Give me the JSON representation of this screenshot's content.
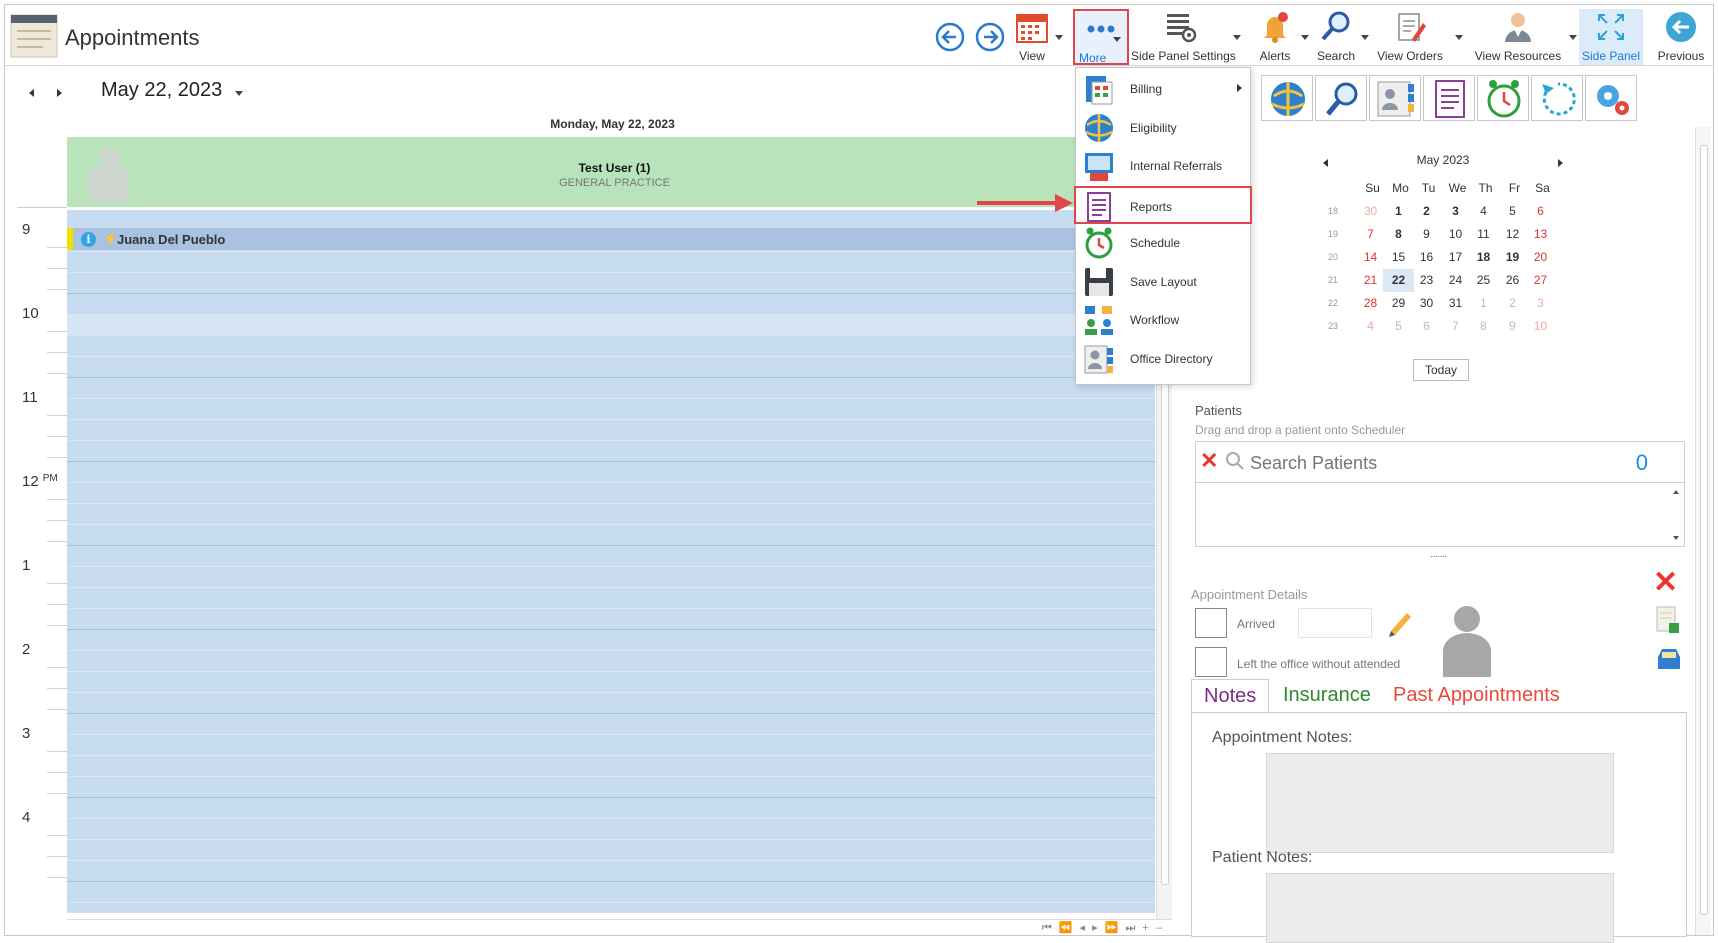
{
  "app": {
    "title": "Appointments"
  },
  "toolbar": {
    "items": [
      {
        "label": "View",
        "icon": "calendar-icon"
      },
      {
        "label": "More",
        "icon": "more-dots-icon"
      },
      {
        "label": "Side Panel Settings",
        "icon": "panel-settings-icon"
      },
      {
        "label": "Alerts",
        "icon": "bell-icon"
      },
      {
        "label": "Search",
        "icon": "search-icon"
      },
      {
        "label": "View Orders",
        "icon": "orders-icon"
      },
      {
        "label": "View Resources",
        "icon": "resources-icon"
      },
      {
        "label": "Side Panel",
        "icon": "expand-icon"
      },
      {
        "label": "Previous",
        "icon": "back-arrow-icon"
      }
    ]
  },
  "scheduler": {
    "current_date": "May 22, 2023",
    "day_header": "Monday, May 22, 2023",
    "resource": {
      "name": "Test User (1)",
      "subtitle": "GENERAL PRACTICE"
    },
    "hours": [
      "9",
      "10",
      "11",
      "12",
      "1",
      "2",
      "3",
      "4"
    ],
    "pm_label": "PM",
    "appointment": {
      "patient": "Juana Del Pueblo",
      "hour": "9"
    },
    "hscroll_nav": "⏮ ⏪ ◂ ▸ ⏩ ⏭ + –"
  },
  "more_menu": {
    "items": [
      {
        "label": "Billing",
        "icon": "billing-icon",
        "has_submenu": true
      },
      {
        "label": "Eligibility",
        "icon": "eligibility-icon",
        "has_submenu": false
      },
      {
        "label": "Internal Referrals",
        "icon": "referrals-icon",
        "has_submenu": false
      },
      {
        "label": "Reports",
        "icon": "reports-icon",
        "has_submenu": false,
        "highlighted": true
      },
      {
        "label": "Schedule",
        "icon": "alarm-clock-icon",
        "has_submenu": false
      },
      {
        "label": "Save Layout",
        "icon": "floppy-disk-icon",
        "has_submenu": false
      },
      {
        "label": "Workflow",
        "icon": "workflow-icon",
        "has_submenu": false
      },
      {
        "label": "Office Directory",
        "icon": "directory-icon",
        "has_submenu": false
      }
    ]
  },
  "side_panel": {
    "quick_icons": [
      "eligibility-icon",
      "search-icon",
      "directory-icon",
      "reports-icon",
      "alarm-clock-icon",
      "refresh-icon",
      "settings-gears-icon"
    ],
    "calendar": {
      "month_label": "May 2023",
      "weekdays": [
        "Su",
        "Mo",
        "Tu",
        "We",
        "Th",
        "Fr",
        "Sa"
      ],
      "weeks": [
        {
          "wk": "18",
          "days": [
            "30",
            "1",
            "2",
            "3",
            "4",
            "5",
            "6"
          ]
        },
        {
          "wk": "19",
          "days": [
            "7",
            "8",
            "9",
            "10",
            "11",
            "12",
            "13"
          ]
        },
        {
          "wk": "20",
          "days": [
            "14",
            "15",
            "16",
            "17",
            "18",
            "19",
            "20"
          ]
        },
        {
          "wk": "21",
          "days": [
            "21",
            "22",
            "23",
            "24",
            "25",
            "26",
            "27"
          ]
        },
        {
          "wk": "22",
          "days": [
            "28",
            "29",
            "30",
            "31",
            "1",
            "2",
            "3"
          ]
        },
        {
          "wk": "23",
          "days": [
            "4",
            "5",
            "6",
            "7",
            "8",
            "9",
            "10"
          ]
        }
      ],
      "selected": "22",
      "today_label": "Today"
    },
    "patients": {
      "title": "Patients",
      "hint": "Drag and drop a patient onto Scheduler",
      "search_placeholder": "Search Patients",
      "count": "0"
    },
    "appointment_details": {
      "title": "Appointment Details",
      "arrived_label": "Arrived",
      "left_label": "Left the office without attended"
    },
    "tabs": [
      "Notes",
      "Insurance",
      "Past Appointments"
    ],
    "notes": {
      "appointment_notes_label": "Appointment Notes:",
      "patient_notes_label": "Patient Notes:"
    },
    "colors": {
      "accent": "#1f7bd0",
      "highlight": "#e0474c",
      "resource_bg": "#b8e3bb",
      "grid_bg": "#c7dbf1"
    }
  }
}
